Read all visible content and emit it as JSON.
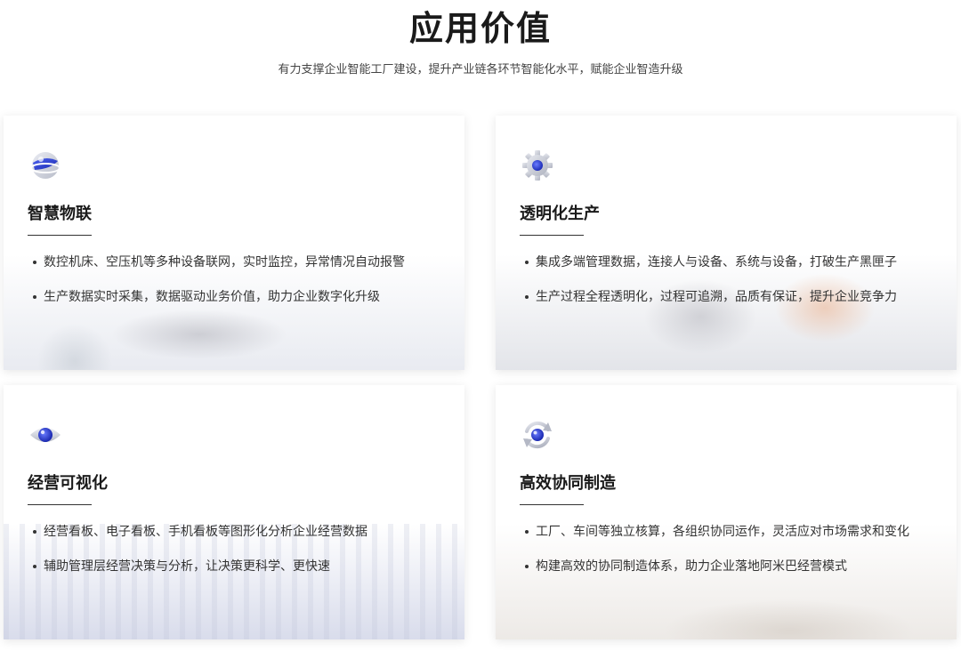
{
  "header": {
    "title": "应用价值",
    "subtitle": "有力支撑企业智能工厂建设，提升产业链各环节智能化水平，赋能企业智造升级"
  },
  "cards": [
    {
      "icon": "globe-icon",
      "title": "智慧物联",
      "items": [
        "数控机床、空压机等多种设备联网，实时监控，异常情况自动报警",
        "生产数据实时采集，数据驱动业务价值，助力企业数字化升级"
      ]
    },
    {
      "icon": "gear-icon",
      "title": "透明化生产",
      "items": [
        "集成多端管理数据，连接人与设备、系统与设备，打破生产黑匣子",
        "生产过程全程透明化，过程可追溯，品质有保证，提升企业竞争力"
      ]
    },
    {
      "icon": "eye-icon",
      "title": "经营可视化",
      "items": [
        "经营看板、电子看板、手机看板等图形化分析企业经营数据",
        "辅助管理层经营决策与分析，让决策更科学、更快速"
      ]
    },
    {
      "icon": "sync-icon",
      "title": "高效协同制造",
      "items": [
        "工厂、车间等独立核算，各组织协同运作，灵活应对市场需求和变化",
        "构建高效的协同制造体系，助力企业落地阿米巴经营模式"
      ]
    }
  ],
  "colors": {
    "accent_blue": "#2b3fd6",
    "icon_grey": "#c8cad2"
  }
}
